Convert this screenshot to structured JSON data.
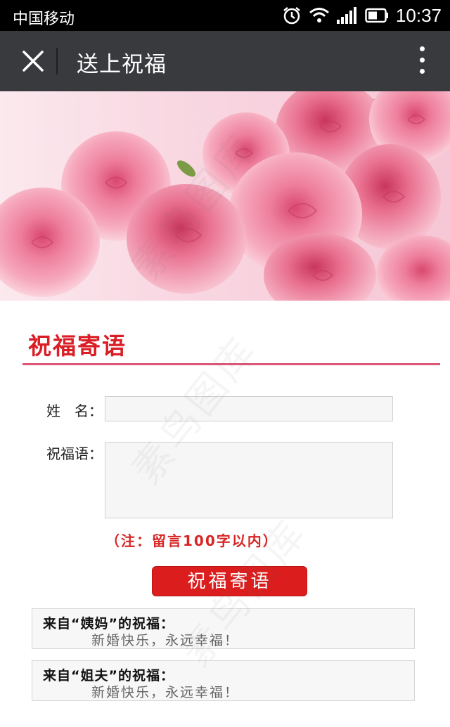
{
  "status_bar": {
    "carrier": "中国移动",
    "time": "10:37",
    "icons": [
      "alarm-icon",
      "wifi-icon",
      "signal-icon",
      "battery-icon"
    ]
  },
  "nav": {
    "title": "送上祝福",
    "close_icon": "close-icon",
    "more_icon": "more-vertical-icon"
  },
  "banner": {
    "image": "pink-roses-banner"
  },
  "section": {
    "title": "祝福寄语"
  },
  "form": {
    "name_label": "姓　名：",
    "name_value": "",
    "message_label": "祝福语：",
    "message_value": "",
    "note": "（注：留言100字以内）",
    "submit_label": "祝福寄语"
  },
  "messages": [
    {
      "from": "来自“姨妈”的祝福：",
      "text": "新婚快乐，永远幸福！"
    },
    {
      "from": "来自“姐夫”的祝福：",
      "text": "新婚快乐，永远幸福！"
    }
  ],
  "colors": {
    "accent": "#d91e25",
    "nav_bg": "#393a3e",
    "rule": "#dc5778"
  },
  "watermark": "素鸟图库"
}
